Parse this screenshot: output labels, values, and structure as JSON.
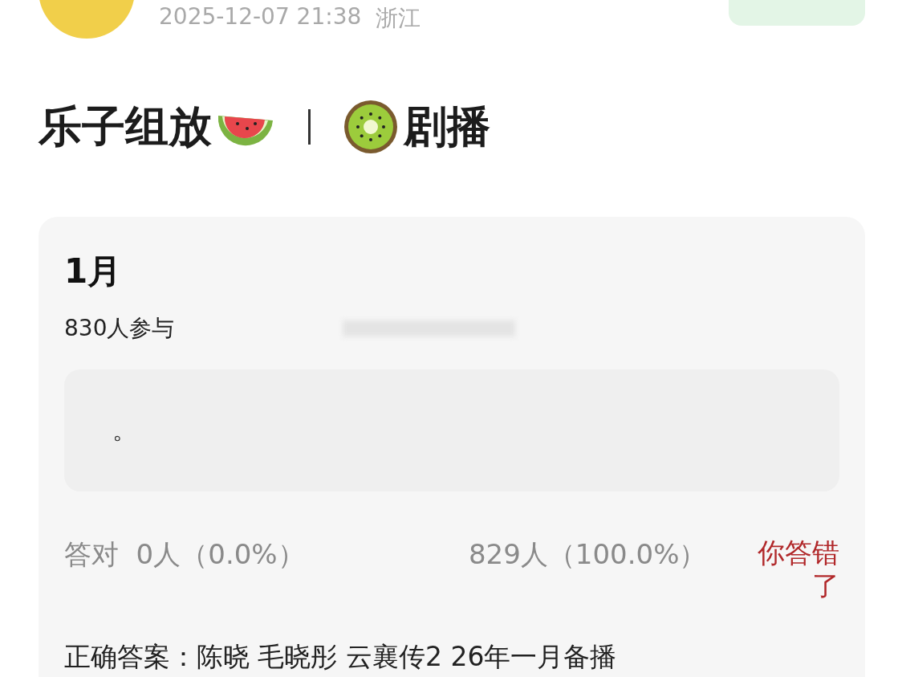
{
  "post_header": {
    "timestamp": "2025-12-07 21:38",
    "location": "浙江"
  },
  "post_title": {
    "before": "乐子组放",
    "after": "剧播"
  },
  "quiz_card": {
    "title": "1月",
    "participants": "830人参与",
    "options": [
      {
        "text": "。",
        "selected": false
      }
    ],
    "correct_label": "答对",
    "correct_count": "0人（0.0%）",
    "wrong_count": "829人（100.0%）",
    "verdict": "你答错了",
    "answer": "正确答案：陈晓 毛晓彤 云襄传2 26年一月备播"
  }
}
